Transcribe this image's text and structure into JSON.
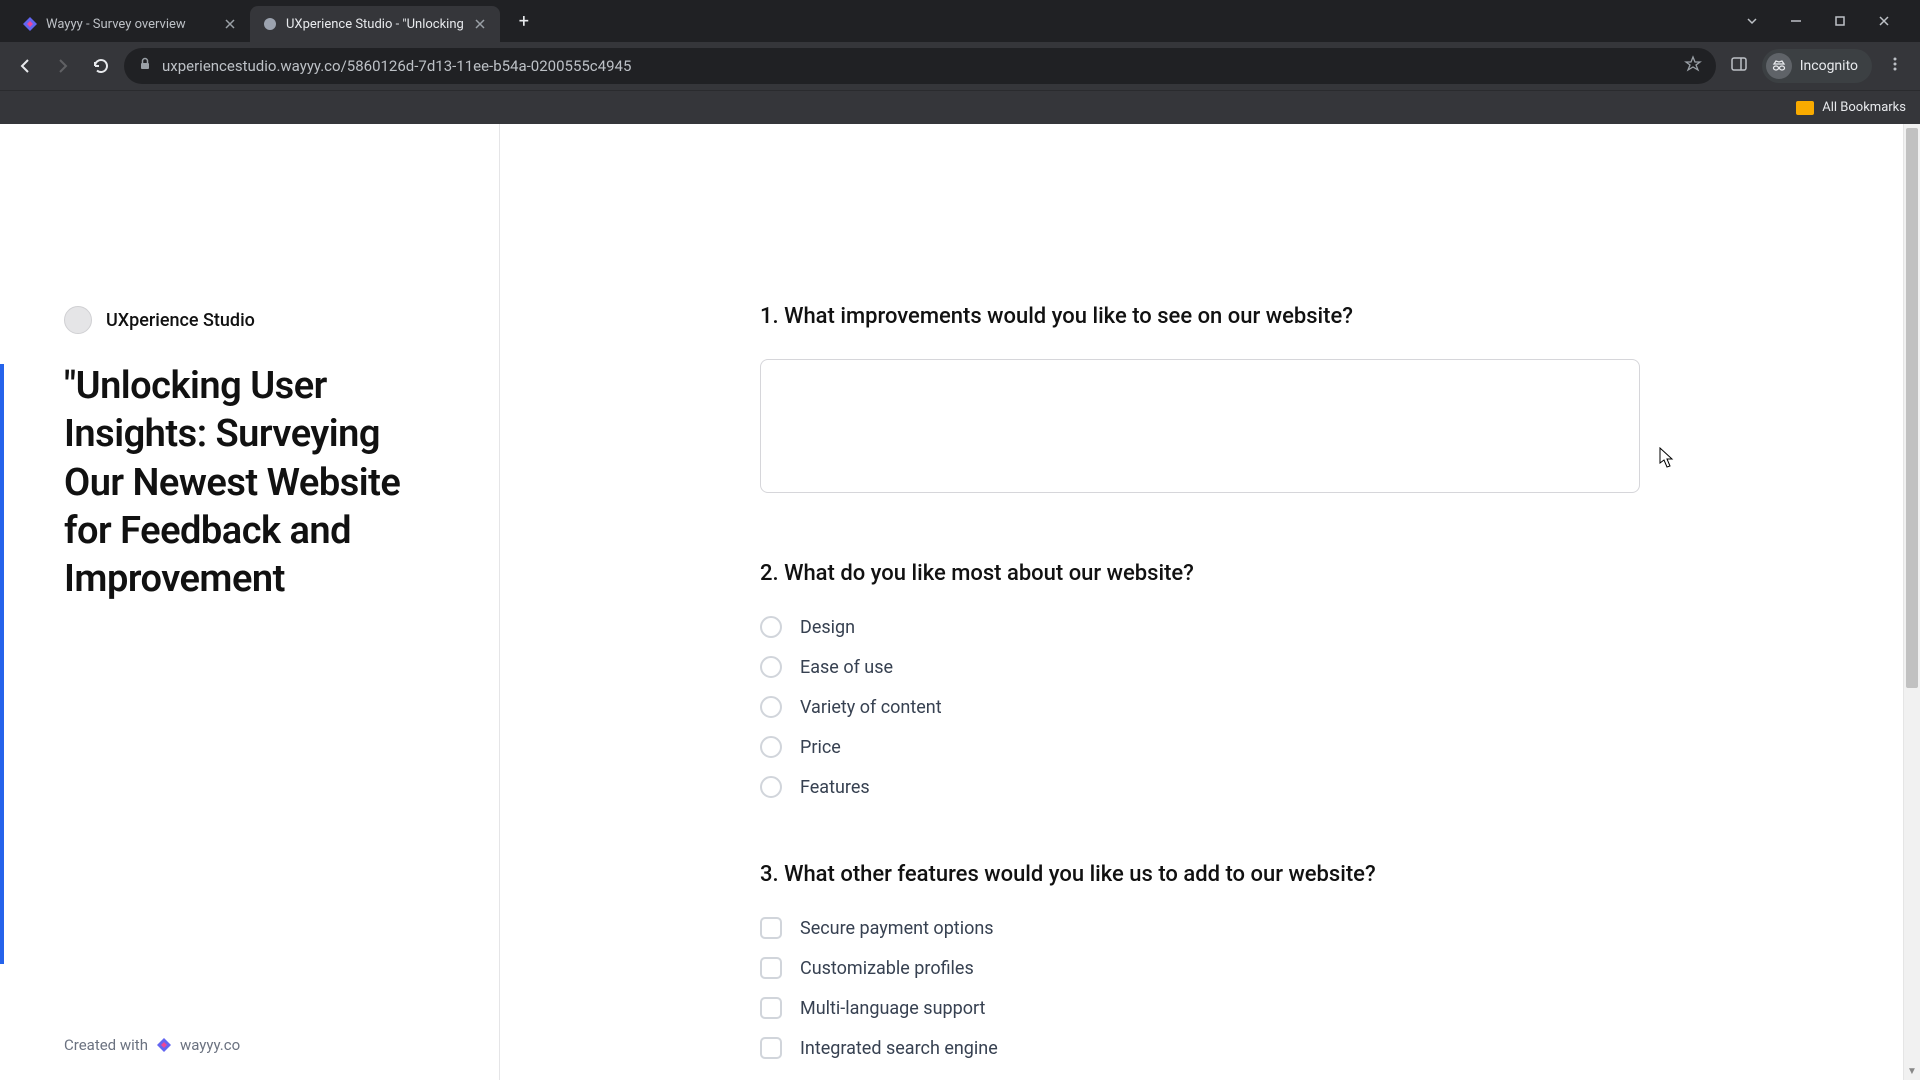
{
  "browser": {
    "tabs": [
      {
        "title": "Wayyy - Survey overview",
        "active": false
      },
      {
        "title": "UXperience Studio - \"Unlocking",
        "active": true
      }
    ],
    "url": "uxperiencestudio.wayyy.co/5860126d-7d13-11ee-b54a-0200555c4945",
    "incognito_label": "Incognito",
    "all_bookmarks_label": "All Bookmarks"
  },
  "sidebar": {
    "org_name": "UXperience Studio",
    "survey_title": "\"Unlocking User Insights: Surveying Our Newest Website for Feedback and Improvement",
    "created_with": "Created with",
    "wayyy_label": "wayyy.co"
  },
  "questions": {
    "q1": {
      "label": "1. What improvements would you like to see on our website?",
      "value": ""
    },
    "q2": {
      "label": "2. What do you like most about our website?",
      "options": [
        "Design",
        "Ease of use",
        "Variety of content",
        "Price",
        "Features"
      ]
    },
    "q3": {
      "label": "3. What other features would you like us to add to our website?",
      "options": [
        "Secure payment options",
        "Customizable profiles",
        "Multi-language support",
        "Integrated search engine"
      ]
    }
  }
}
